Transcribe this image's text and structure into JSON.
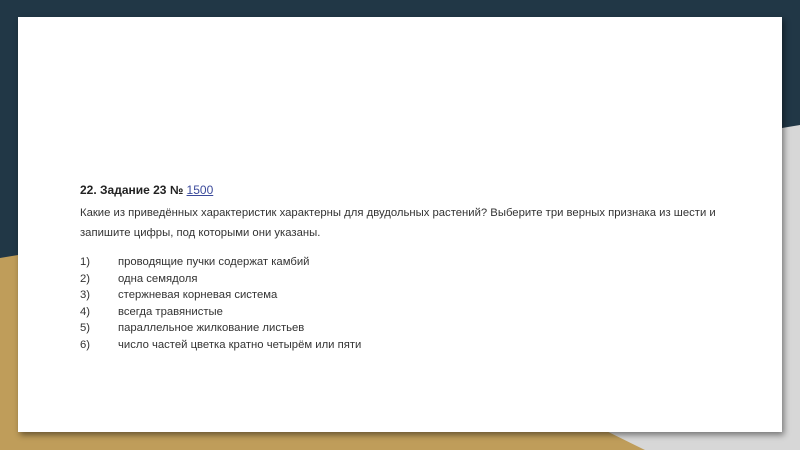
{
  "task": {
    "title_prefix": "22. Задание 23 №",
    "task_number_link": "1500",
    "question": "Какие из приведённых характеристик характерны для двудольных растений? Выберите три верных признака из шести и запишите цифры, под которыми они указаны.",
    "options": [
      {
        "num": "1)",
        "text": "проводящие пучки содержат камбий"
      },
      {
        "num": "2)",
        "text": "одна семядоля"
      },
      {
        "num": "3)",
        "text": "стержневая корневая система"
      },
      {
        "num": "4)",
        "text": "всегда травянистые"
      },
      {
        "num": "5)",
        "text": "параллельное жилкование листьев"
      },
      {
        "num": "6)",
        "text": "число частей цветка кратно четырём или пяти"
      }
    ]
  },
  "colors": {
    "navy": "#213746",
    "gold": "#bf9d5a",
    "gray": "#d7d7d7",
    "link": "#3b4a9b"
  }
}
